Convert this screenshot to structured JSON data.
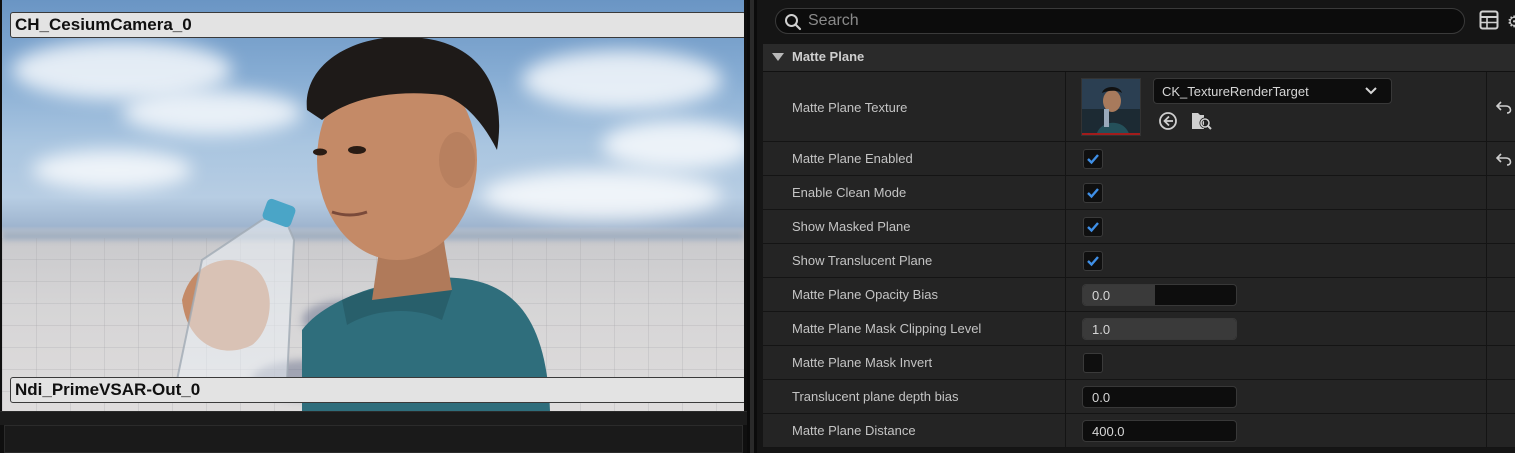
{
  "viewport": {
    "top_camera_label": "CH_CesiumCamera_0",
    "bottom_camera_label": "Ndi_PrimeVSAR-Out_0"
  },
  "details": {
    "search": {
      "placeholder": "Search",
      "value": ""
    },
    "category": {
      "title": "Matte Plane",
      "expanded": true
    },
    "properties": [
      {
        "name": "Matte Plane Texture",
        "type": "texture",
        "value": "CK_TextureRenderTarget",
        "has_reset": true
      },
      {
        "name": "Matte Plane Enabled",
        "type": "checkbox",
        "checked": true,
        "has_reset": true
      },
      {
        "name": "Enable Clean Mode",
        "type": "checkbox",
        "checked": true,
        "has_reset": false
      },
      {
        "name": "Show Masked Plane",
        "type": "checkbox",
        "checked": true,
        "has_reset": false
      },
      {
        "name": "Show Translucent Plane",
        "type": "checkbox",
        "checked": true,
        "has_reset": false
      },
      {
        "name": "Matte Plane Opacity Bias",
        "type": "slider",
        "value": "0.0",
        "fill_fraction": 0.47,
        "has_reset": false
      },
      {
        "name": "Matte Plane Mask Clipping Level",
        "type": "slider",
        "value": "1.0",
        "fill_fraction": 1.0,
        "has_reset": false
      },
      {
        "name": "Matte Plane Mask Invert",
        "type": "checkbox",
        "checked": false,
        "has_reset": false
      },
      {
        "name": "Translucent plane depth bias",
        "type": "number",
        "value": "0.0",
        "has_reset": false
      },
      {
        "name": "Matte Plane Distance",
        "type": "number",
        "value": "400.0",
        "has_reset": false
      }
    ]
  },
  "colors": {
    "checkmark": "#3f8fe6",
    "panel_bg": "#242424",
    "category_bg": "#2a2a2a"
  },
  "icons": {
    "search": "search-icon",
    "view_options": "table-view-icon",
    "use_selected": "use-selected-asset-icon",
    "browse": "browse-asset-icon",
    "reset": "reset-to-default-icon"
  }
}
